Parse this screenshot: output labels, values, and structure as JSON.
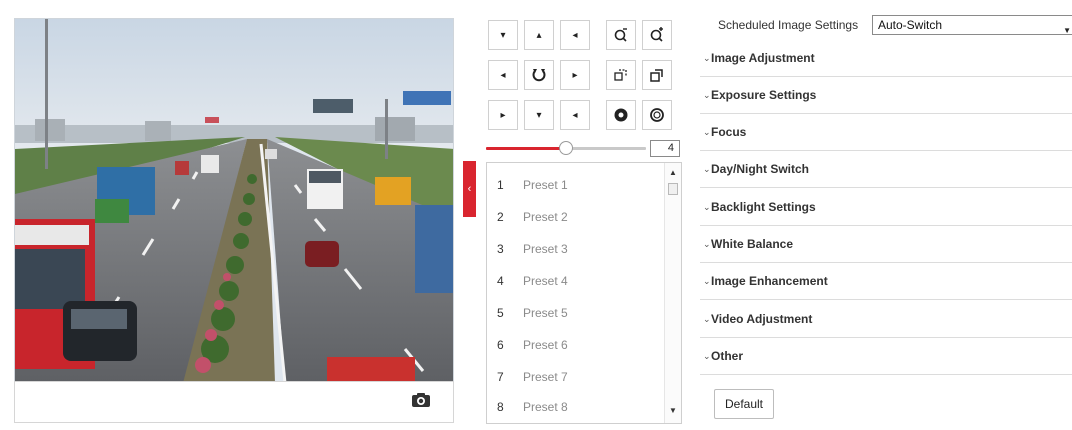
{
  "live_view": {
    "snapshot_icon": "camera-icon",
    "scene": "highway-traffic-camera-feed"
  },
  "collapse_handle": {
    "icon": "chevron-left-icon",
    "glyph": "‹"
  },
  "ptz": {
    "buttons": [
      {
        "name": "pan-up-left-button",
        "icon": "arrow-up-left-icon",
        "glyph": "▾"
      },
      {
        "name": "tilt-up-button",
        "icon": "arrow-up-icon",
        "glyph": "▴"
      },
      {
        "name": "pan-up-right-button",
        "icon": "arrow-up-right-icon",
        "glyph": "◂"
      },
      {
        "name": "zoom-out-button",
        "icon": "zoom-out-icon"
      },
      {
        "name": "zoom-in-button",
        "icon": "zoom-in-icon"
      },
      {
        "name": "pan-left-button",
        "icon": "arrow-left-icon",
        "glyph": "◂"
      },
      {
        "name": "auto-pan-button",
        "icon": "auto-rotate-icon"
      },
      {
        "name": "pan-right-button",
        "icon": "arrow-right-icon",
        "glyph": "▸"
      },
      {
        "name": "focus-near-button",
        "icon": "focus-near-icon"
      },
      {
        "name": "focus-far-button",
        "icon": "focus-far-icon"
      },
      {
        "name": "pan-down-left-button",
        "icon": "arrow-down-left-icon",
        "glyph": "▸"
      },
      {
        "name": "tilt-down-button",
        "icon": "arrow-down-icon",
        "glyph": "▾"
      },
      {
        "name": "pan-down-right-button",
        "icon": "arrow-down-right-icon",
        "glyph": "◂"
      },
      {
        "name": "iris-open-button",
        "icon": "iris-open-icon"
      },
      {
        "name": "iris-close-button",
        "icon": "iris-close-icon"
      }
    ],
    "speed": {
      "value": "4",
      "level_fraction": 0.5
    }
  },
  "presets": {
    "items": [
      {
        "num": "1",
        "label": "Preset 1"
      },
      {
        "num": "2",
        "label": "Preset 2"
      },
      {
        "num": "3",
        "label": "Preset 3"
      },
      {
        "num": "4",
        "label": "Preset 4"
      },
      {
        "num": "5",
        "label": "Preset 5"
      },
      {
        "num": "6",
        "label": "Preset 6"
      },
      {
        "num": "7",
        "label": "Preset 7"
      },
      {
        "num": "8",
        "label": "Preset 8"
      }
    ]
  },
  "settings": {
    "scheduled_label": "Scheduled Image Settings",
    "scheduled_value": "Auto-Switch",
    "sections": [
      {
        "name": "section-image-adjustment",
        "title": "Image Adjustment"
      },
      {
        "name": "section-exposure-settings",
        "title": "Exposure Settings"
      },
      {
        "name": "section-focus",
        "title": "Focus"
      },
      {
        "name": "section-day-night-switch",
        "title": "Day/Night Switch"
      },
      {
        "name": "section-backlight-settings",
        "title": "Backlight Settings"
      },
      {
        "name": "section-white-balance",
        "title": "White Balance"
      },
      {
        "name": "section-image-enhancement",
        "title": "Image Enhancement"
      },
      {
        "name": "section-video-adjustment",
        "title": "Video Adjustment"
      },
      {
        "name": "section-other",
        "title": "Other"
      }
    ],
    "default_label": "Default"
  },
  "colors": {
    "accent": "#d9252f",
    "divider": "#dcdcdc"
  }
}
